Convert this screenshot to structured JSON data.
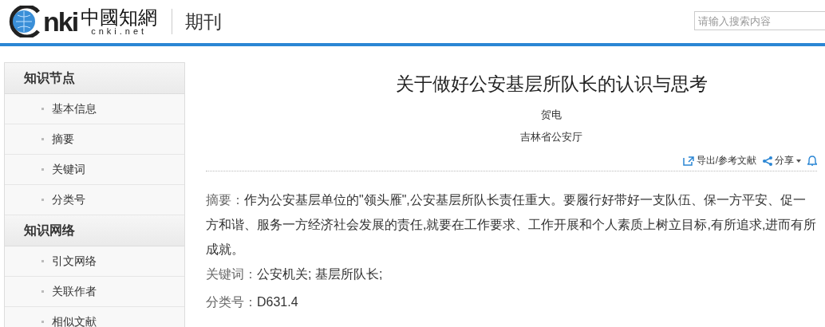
{
  "header": {
    "logo": {
      "mark": "nki",
      "chinese": "中國知網",
      "domain": "cnki.net"
    },
    "section": "期刊",
    "search": {
      "placeholder": "请输入搜索内容"
    }
  },
  "sidebar": {
    "groups": [
      {
        "title": "知识节点",
        "items": [
          {
            "label": "基本信息"
          },
          {
            "label": "摘要"
          },
          {
            "label": "关键词"
          },
          {
            "label": "分类号"
          }
        ]
      },
      {
        "title": "知识网络",
        "items": [
          {
            "label": "引文网络"
          },
          {
            "label": "关联作者"
          },
          {
            "label": "相似文献"
          }
        ]
      }
    ]
  },
  "article": {
    "title": "关于做好公安基层所队长的认识与思考",
    "author": "贺电",
    "affiliation": "吉林省公安厅",
    "actions": [
      {
        "kind": "export",
        "label": "导出/参考文献"
      },
      {
        "kind": "share",
        "label": "分享"
      },
      {
        "kind": "alert"
      }
    ],
    "abstract": {
      "label": "摘要：",
      "text": "作为公安基层单位的\"领头雁\",公安基层所队长责任重大。要履行好带好一支队伍、保一方平安、促一方和谐、服务一方经济社会发展的责任,就要在工作要求、工作开展和个人素质上树立目标,有所追求,进而有所成就。"
    },
    "keywords": {
      "label": "关键词：",
      "items": [
        "公安机关;",
        "基层所队长;"
      ]
    },
    "classification": {
      "label": "分类号：",
      "value": "D631.4"
    }
  }
}
